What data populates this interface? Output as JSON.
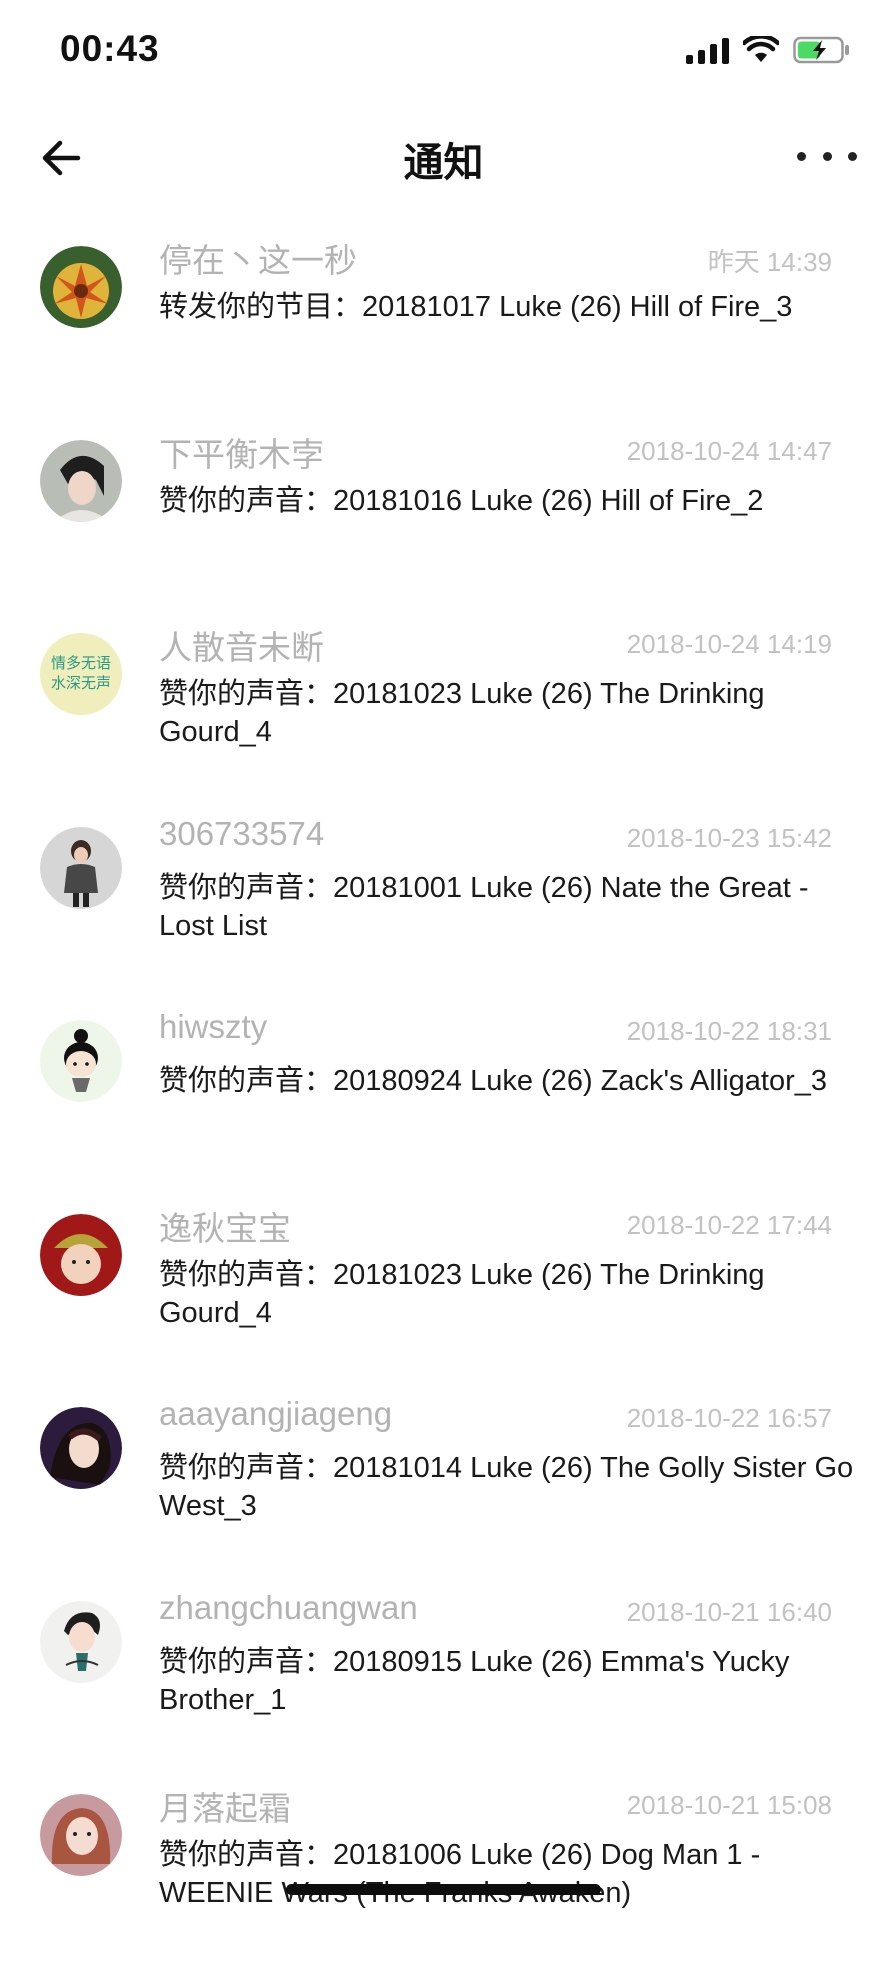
{
  "status_bar": {
    "time": "00:43"
  },
  "header": {
    "title": "通知"
  },
  "notifications": [
    {
      "name": "停在丶这一秒",
      "time": "昨天 14:39",
      "message": "转发你的节目：20181017 Luke (26) Hill of Fire_3",
      "avatar_color": "#d9b13a"
    },
    {
      "name": "下平衡木孛",
      "time": "2018-10-24 14:47",
      "message": "赞你的声音：20181016 Luke (26) Hill of Fire_2",
      "avatar_color": "#8a8f8a"
    },
    {
      "name": "人散音未断",
      "time": "2018-10-24 14:19",
      "message": "赞你的声音：20181023 Luke (26) The Drinking Gourd_4",
      "avatar_color": "#efeebc",
      "avatar_text": "情多无语\n水深无声"
    },
    {
      "name": "306733574",
      "time": "2018-10-23 15:42",
      "message": "赞你的声音：20181001 Luke (26) Nate the Great - Lost List",
      "avatar_color": "#c9c9c9"
    },
    {
      "name": "hiwszty",
      "time": "2018-10-22 18:31",
      "message": "赞你的声音：20180924 Luke (26) Zack's Alligator_3",
      "avatar_color": "#eef6ea"
    },
    {
      "name": "逸秋宝宝",
      "time": "2018-10-22 17:44",
      "message": "赞你的声音：20181023 Luke (26) The Drinking Gourd_4",
      "avatar_color": "#a01818"
    },
    {
      "name": "aaayangjiageng",
      "time": "2018-10-22 16:57",
      "message": "赞你的声音：20181014 Luke (26) The Golly Sister Go West_3",
      "avatar_color": "#2d1b3e"
    },
    {
      "name": "zhangchuangwan",
      "time": "2018-10-21 16:40",
      "message": "赞你的声音：20180915 Luke (26) Emma's Yucky Brother_1",
      "avatar_color": "#f1f1ef"
    },
    {
      "name": "月落起霜",
      "time": "2018-10-21 15:08",
      "message": "赞你的声音：20181006 Luke (26) Dog Man 1 - WEENIE Wars (The Franks Awaken)",
      "avatar_color": "#c79aa0"
    }
  ]
}
